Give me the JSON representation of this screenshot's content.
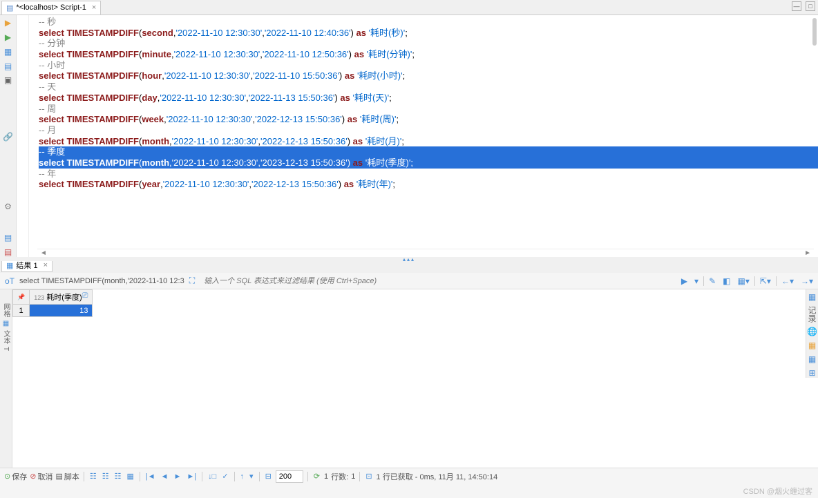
{
  "tab": {
    "title": "*<localhost> Script-1"
  },
  "code": {
    "lines": [
      {
        "t": "comment",
        "text": "-- 秒"
      },
      {
        "t": "sql",
        "unit": "second",
        "d1": "'2022-11-10 12:30:30'",
        "d2": "'2022-11-10 12:40:36'",
        "alias": "'耗时(秒)'"
      },
      {
        "t": "comment",
        "text": "-- 分钟"
      },
      {
        "t": "sql",
        "unit": "minute",
        "d1": "'2022-11-10 12:30:30'",
        "d2": "'2022-11-10 12:50:36'",
        "alias": "'耗时(分钟)'"
      },
      {
        "t": "comment",
        "text": "-- 小时"
      },
      {
        "t": "sql",
        "unit": "hour",
        "d1": "'2022-11-10 12:30:30'",
        "d2": "'2022-11-10 15:50:36'",
        "alias": "'耗时(小时)'"
      },
      {
        "t": "comment",
        "text": "-- 天"
      },
      {
        "t": "sql",
        "unit": "day",
        "d1": "'2022-11-10 12:30:30'",
        "d2": "'2022-11-13 15:50:36'",
        "alias": "'耗时(天)'"
      },
      {
        "t": "comment",
        "text": "-- 周"
      },
      {
        "t": "sql",
        "unit": "week",
        "d1": "'2022-11-10 12:30:30'",
        "d2": "'2022-12-13 15:50:36'",
        "alias": "'耗时(周)'"
      },
      {
        "t": "comment",
        "text": "-- 月"
      },
      {
        "t": "sql",
        "unit": "month",
        "d1": "'2022-11-10 12:30:30'",
        "d2": "'2022-12-13 15:50:36'",
        "alias": "'耗时(月)'"
      },
      {
        "t": "comment",
        "text": "-- 季度",
        "hl": true
      },
      {
        "t": "sql",
        "unit": "month",
        "d1": "'2022-11-10 12:30:30'",
        "d2": "'2023-12-13 15:50:36'",
        "alias": "'耗时(季度)'",
        "hl": true
      },
      {
        "t": "comment",
        "text": "-- 年"
      },
      {
        "t": "sql",
        "unit": "year",
        "d1": "'2022-11-10 12:30:30'",
        "d2": "'2022-12-13 15:50:36'",
        "alias": "'耗时(年)'"
      }
    ],
    "kw_select": "select",
    "kw_as": "as",
    "fn": "TIMESTAMPDIFF"
  },
  "results": {
    "tab": "结果 1",
    "query": "select TIMESTAMPDIFF(month,'2022-11-10 12:3",
    "filter_ph": "输入一个 SQL 表达式来过滤结果 (使用 Ctrl+Space)",
    "col_prefix": "123",
    "col": "耗时(季度)",
    "rows": [
      {
        "n": "1",
        "v": "13"
      }
    ]
  },
  "sidetabs": {
    "l1": "网格",
    "l2": "文本",
    "l3": "记录"
  },
  "footer": {
    "save": "保存",
    "cancel": "取消",
    "script": "脚本",
    "limit": "200",
    "refresh": "1",
    "rows_lbl": "行数:",
    "rows": "1",
    "status": "1 行已获取 - 0ms, 11月 11, 14:50:14"
  },
  "watermark": "CSDN @烟火缠过客"
}
